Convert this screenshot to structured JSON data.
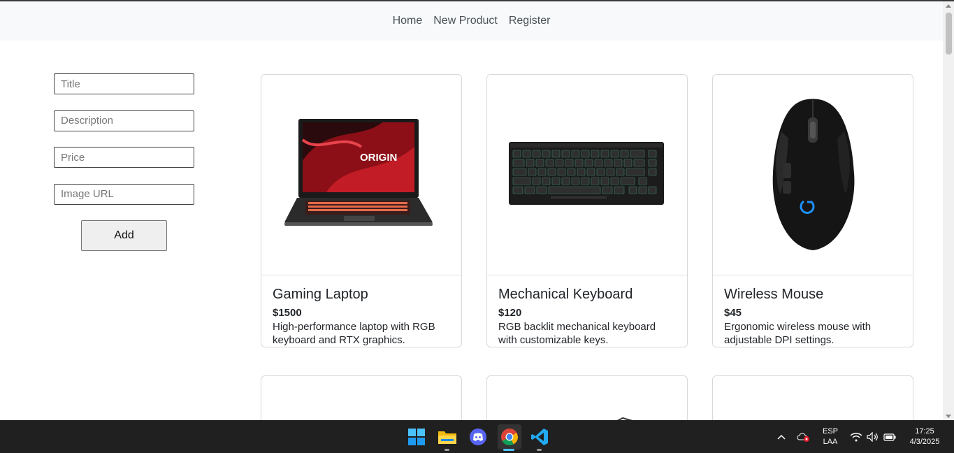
{
  "nav": {
    "items": [
      "Home",
      "New Product",
      "Register"
    ]
  },
  "form": {
    "title_placeholder": "Title",
    "description_placeholder": "Description",
    "price_placeholder": "Price",
    "image_placeholder": "Image URL",
    "add_label": "Add"
  },
  "products": [
    {
      "title": "Gaming Laptop",
      "price": "$1500",
      "description": "High-performance laptop with RGB keyboard and RTX graphics.",
      "image_icon": "laptop-image"
    },
    {
      "title": "Mechanical Keyboard",
      "price": "$120",
      "description": "RGB backlit mechanical keyboard with customizable keys.",
      "image_icon": "keyboard-image"
    },
    {
      "title": "Wireless Mouse",
      "price": "$45",
      "description": "Ergonomic wireless mouse with adjustable DPI settings.",
      "image_icon": "mouse-image"
    }
  ],
  "taskbar": {
    "apps": [
      "windows-start-icon",
      "file-explorer-icon",
      "discord-icon",
      "chrome-icon",
      "vscode-icon"
    ],
    "language": "ESP",
    "layout": "LAA",
    "time": "17:25",
    "date": "4/3/2025"
  },
  "colors": {
    "navbar_bg": "#f8f9fa",
    "taskbar_bg": "#202020",
    "laptop_logo_text": "ORIGIN"
  }
}
